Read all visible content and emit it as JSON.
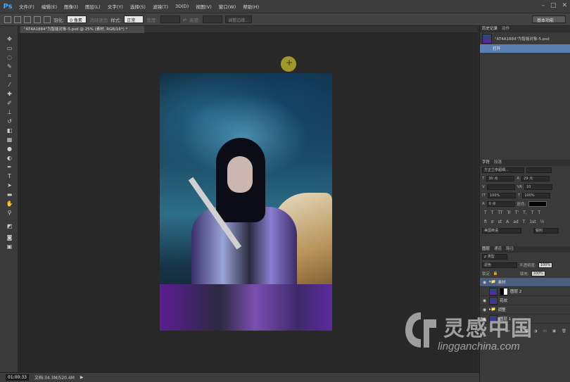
{
  "app": {
    "logo": "Ps"
  },
  "menu": [
    "文件(F)",
    "编辑(E)",
    "图像(I)",
    "图层(L)",
    "文字(Y)",
    "选择(S)",
    "滤镜(T)",
    "3D(D)",
    "视图(V)",
    "窗口(W)",
    "帮助(H)"
  ],
  "options": {
    "feather_label": "羽化:",
    "feather_value": "0 像素",
    "antialias_label": "消除锯齿",
    "style_label": "样式:",
    "style_value": "正常",
    "width_label": "宽度:",
    "height_label": "高度:",
    "refine_edge": "调整边缘...",
    "workspace": "基本功能"
  },
  "document": {
    "tab_title": "\"AT4A1884\"为智能对象-5.psd @ 25% (素材, RGB/16*) *"
  },
  "status": {
    "timer": "01:00:33",
    "doc_info": "文档:34.3M/520.4M"
  },
  "history_panel": {
    "tabs": [
      "历史记录",
      "动作"
    ],
    "snapshot_label": "\"AT4A1884\"为智能对象-5.psd",
    "steps": [
      "打开"
    ]
  },
  "character_panel": {
    "tabs": [
      "字符",
      "段落"
    ],
    "font_family": "方正兰亭超细...",
    "font_size": "30 点",
    "leading": "29 点",
    "tracking": "10",
    "vertical_scale": "100%",
    "horizontal_scale": "100%",
    "baseline": "0 点",
    "color_label": "颜色:",
    "language": "美国英语",
    "antialias": "锐利",
    "glyphs": [
      "T",
      "T",
      "TT",
      "Tr",
      "T'",
      "T,",
      "T",
      "T"
    ],
    "opentype": [
      "fi",
      "σ",
      "st",
      "A",
      "ad",
      "T",
      "1st",
      "½"
    ]
  },
  "layers_panel": {
    "tabs": [
      "图层",
      "通道",
      "路径"
    ],
    "filter_label": "ρ 类型",
    "blend_mode": "滤色",
    "opacity_label": "不透明度:",
    "opacity_value": "100%",
    "lock_label": "锁定:",
    "fill_label": "填充:",
    "fill_value": "100%",
    "layers": [
      "素材",
      "图层 2",
      "花纹",
      "调整",
      "图层 1"
    ]
  },
  "watermark": {
    "title": "灵感中国",
    "url": "lingganchina.com"
  },
  "colors": {
    "ps_blue": "#3da8f5",
    "selected_row": "#5a7fb0",
    "panel_bg": "#3a3a3a"
  }
}
